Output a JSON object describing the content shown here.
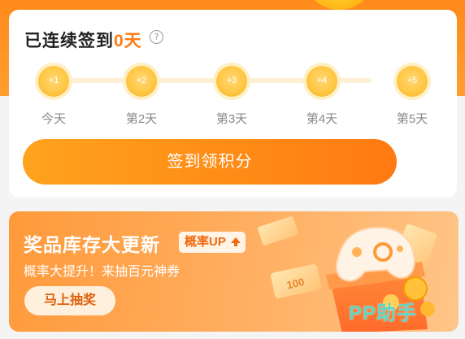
{
  "colors": {
    "brand_orange": "#ff7a12",
    "coin_gold": "#ffc846",
    "watermark_teal": "#5fd6c4"
  },
  "sign_in": {
    "title_prefix": "已连续签到",
    "streak_days": "0天",
    "help_icon": "?",
    "days": [
      {
        "reward": "+1",
        "label": "今天"
      },
      {
        "reward": "+2",
        "label": "第2天"
      },
      {
        "reward": "+3",
        "label": "第3天"
      },
      {
        "reward": "+4",
        "label": "第4天"
      },
      {
        "reward": "+5",
        "label": "第5天"
      }
    ],
    "button_label": "签到领积分"
  },
  "banner": {
    "title": "奖品库存大更新",
    "badge": "概率UP",
    "subtitle": "概率大提升！来抽百元神券",
    "button_label": "马上抽奖",
    "coupon_value": "100"
  },
  "watermark": "PP助手"
}
